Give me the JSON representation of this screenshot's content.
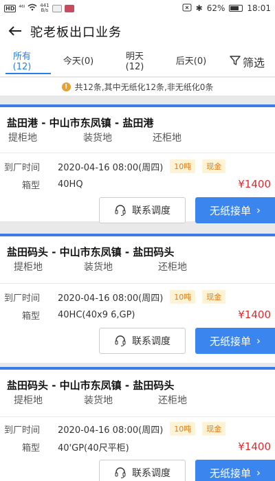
{
  "status_bar": {
    "left_hd": "HD",
    "left_signal": "⁴⁶ᴵ",
    "net_speed_top": "441",
    "net_speed_bottom": "B/s",
    "battery": "62%",
    "time": "18:01"
  },
  "header": {
    "title": "驼老板出口业务"
  },
  "tabs": [
    {
      "label_line1": "所有",
      "label_line2": "(12)"
    },
    {
      "label_line1": "今天(0)",
      "label_line2": ""
    },
    {
      "label_line1": "明天",
      "label_line2": "(12)"
    },
    {
      "label_line1": "后天(0)",
      "label_line2": ""
    }
  ],
  "filter_label": "筛选",
  "notice": {
    "text": "共12条,其中无纸化12条,非无纸化0条"
  },
  "labels": {
    "pickup": "提柜地",
    "loading": "装货地",
    "return": "还柜地",
    "arrival_time": "到厂时间",
    "box_type": "箱型",
    "contact_btn": "联系调度",
    "accept_btn": "无纸接单"
  },
  "orders": [
    {
      "route": "盐田港  - 中山市东凤镇 -  盐田港",
      "arrival": "2020-04-16 08:00(周四)",
      "box": "40HQ",
      "weight_tag": "10吨",
      "pay_tag": "现金",
      "price": "¥1400"
    },
    {
      "route": "盐田码头 - 中山市东凤镇 - 盐田码头",
      "arrival": "2020-04-16 08:00(周四)",
      "box": "40HC(40x9 6,GP)",
      "weight_tag": "10吨",
      "pay_tag": "现金",
      "price": "¥1400"
    },
    {
      "route": "盐田码头 - 中山市东凤镇 - 盐田码头",
      "arrival": "2020-04-16 08:00(周四)",
      "box": "40'GP(40尺平柜)",
      "weight_tag": "10吨",
      "pay_tag": "现金",
      "price": "¥1400"
    }
  ],
  "colors": {
    "accent": "#3b86ee",
    "price": "#e0292d",
    "tag_text": "#e07a1a",
    "tag_bg": "#fff3d6"
  }
}
